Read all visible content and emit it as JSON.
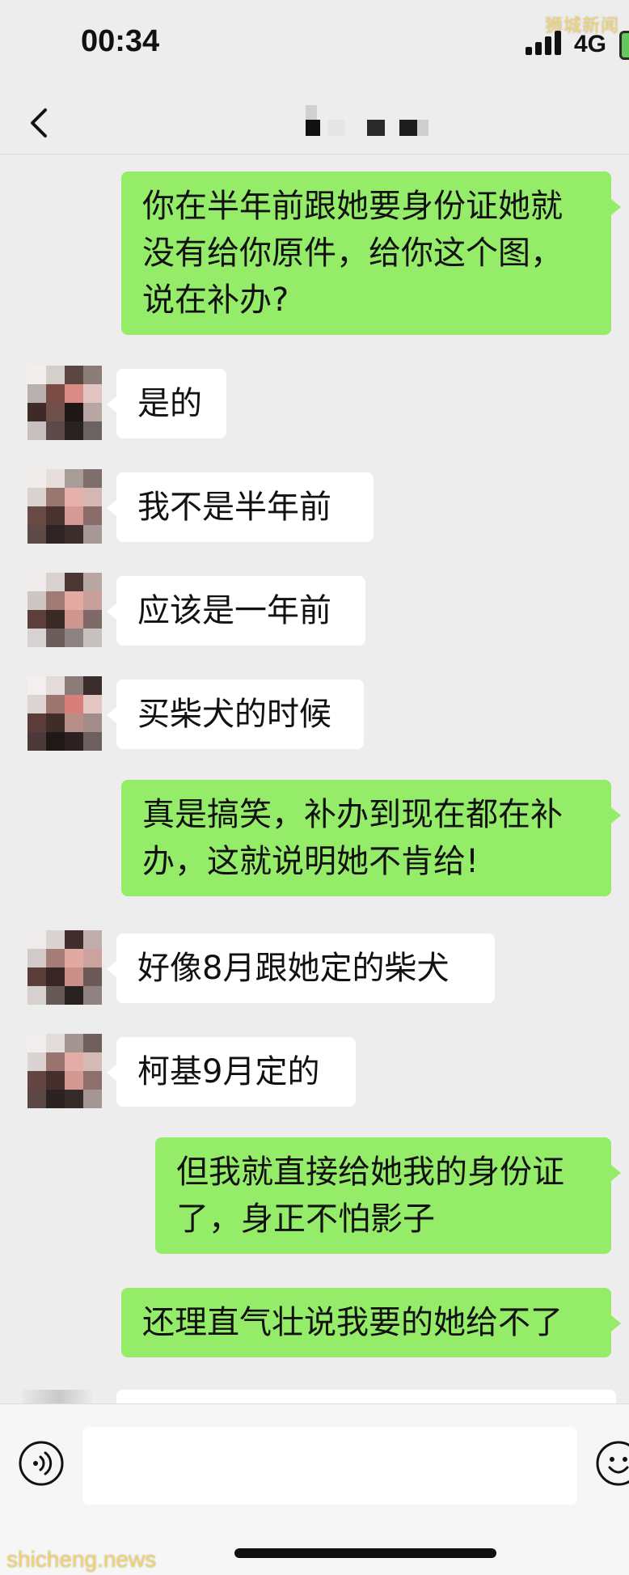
{
  "watermark_top": "狮城新闻",
  "watermark_bottom": "shicheng.news",
  "status_bar": {
    "time": "00:34",
    "network": "4G"
  },
  "nav": {
    "title": ""
  },
  "messages": [
    {
      "side": "out",
      "text": "你在半年前跟她要身份证她就\n没有给你原件，给你这个图，\n说在补办?"
    },
    {
      "side": "in",
      "text": "是的"
    },
    {
      "side": "in",
      "text": "我不是半年前"
    },
    {
      "side": "in",
      "text": "应该是一年前"
    },
    {
      "side": "in",
      "text": "买柴犬的时候"
    },
    {
      "side": "out",
      "text": "真是搞笑，补办到现在都在补\n办，这就说明她不肯给!"
    },
    {
      "side": "in",
      "text": "好像8月跟她定的柴犬"
    },
    {
      "side": "in",
      "text": "柯基9月定的"
    },
    {
      "side": "out",
      "text": "但我就直接给她我的身份证\n了，身正不怕影子"
    },
    {
      "side": "out",
      "text": "还理直气壮说我要的她给不了"
    }
  ],
  "input": {
    "value": "",
    "placeholder": ""
  },
  "colors": {
    "outgoing": "#95ec69",
    "incoming": "#ffffff",
    "background": "#ededed"
  }
}
